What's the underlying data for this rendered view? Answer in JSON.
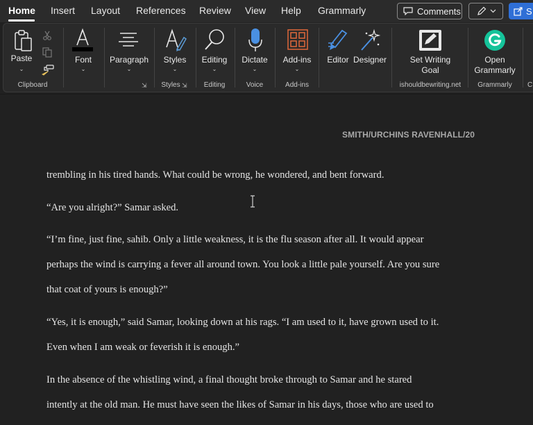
{
  "menubar": {
    "tabs": [
      {
        "label": "Home",
        "active": true
      },
      {
        "label": "Insert"
      },
      {
        "label": "Layout"
      },
      {
        "label": "References"
      },
      {
        "label": "Review"
      },
      {
        "label": "View"
      },
      {
        "label": "Help"
      },
      {
        "label": "Grammarly"
      }
    ],
    "comments_label": "Comments",
    "share_label": "S"
  },
  "ribbon": {
    "clipboard": {
      "paste_label": "Paste",
      "group_label": "Clipboard"
    },
    "font": {
      "label": "Font"
    },
    "paragraph": {
      "label": "Paragraph"
    },
    "styles": {
      "label": "Styles",
      "group_label": "Styles"
    },
    "editing": {
      "label": "Editing",
      "group_label": "Editing"
    },
    "voice": {
      "dictate_label": "Dictate",
      "group_label": "Voice"
    },
    "addins": {
      "label": "Add-ins",
      "group_label": "Add-ins"
    },
    "editor": {
      "label": "Editor"
    },
    "designer": {
      "label": "Designer"
    },
    "writing_goal": {
      "label_line1": "Set Writing",
      "label_line2": "Goal",
      "group_label": "ishouldbewriting.net"
    },
    "grammarly": {
      "label_line1": "Open",
      "label_line2": "Grammarly",
      "group_label": "Grammarly"
    },
    "cut_group_label": "C"
  },
  "document": {
    "header": "SMITH/URCHINS RAVENHALL/20",
    "paragraphs": [
      [
        "trembling in his tired hands. What could be wrong, he wondered, and bent forward."
      ],
      [
        "“Are you alright?” Samar asked."
      ],
      [
        "“I’m fine, just fine, sahib. Only a little weakness, it is the flu season after all. It would appear",
        "perhaps the wind is carrying a fever all around town. You look a little pale yourself. Are you sure",
        "that coat of yours is enough?”"
      ],
      [
        "“Yes, it is enough,” said Samar, looking down at his rags. “I am used to it, have grown used to it.",
        "Even when I am weak or feverish it is enough.”"
      ],
      [
        "In the absence of the whistling wind, a final thought broke through to Samar and he stared",
        "intently at the old man.  He must have seen the likes of Samar in his days, those who are used to"
      ]
    ]
  }
}
